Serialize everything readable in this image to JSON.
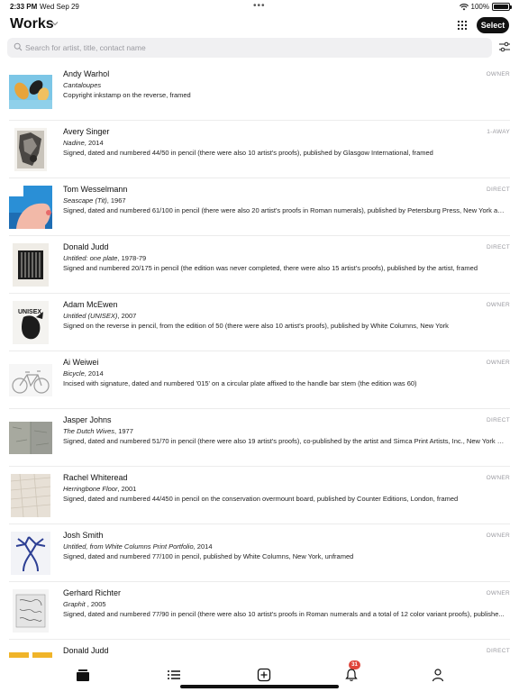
{
  "status": {
    "time": "2:33 PM",
    "date": "Wed Sep 29",
    "battery": "100%"
  },
  "header": {
    "title": "Works",
    "select_label": "Select"
  },
  "search": {
    "placeholder": "Search for artist, title, contact name"
  },
  "works": [
    {
      "artist": "Andy Warhol",
      "title": "Cantaloupes",
      "year": "",
      "description": "Copyright inkstamp on the reverse, framed",
      "relation": "OWNER"
    },
    {
      "artist": "Avery Singer",
      "title": "Nadine",
      "year": ", 2014",
      "description": "Signed, dated and numbered 44/50 in pencil (there were also 10 artist's proofs), published by Glasgow International, framed",
      "relation": "1-AWAY"
    },
    {
      "artist": "Tom Wesselmann",
      "title": "Seascape (Tit)",
      "year": ", 1967",
      "description": "Signed, dated and numbered 61/100 in pencil (there were also 20 artist's proofs in Roman numerals), published by Petersburg Press, New York and...",
      "relation": "DIRECT"
    },
    {
      "artist": "Donald Judd",
      "title": "Untitled: one plate",
      "year": ", 1978-79",
      "description": "Signed and numbered 20/175 in pencil (the edition was never completed, there were also 15 artist's proofs), published by the artist, framed",
      "relation": "DIRECT"
    },
    {
      "artist": "Adam McEwen",
      "title": "Untitled (UNISEX)",
      "year": ", 2007",
      "description": "Signed on the reverse in pencil, from the edition of 50 (there were also 10 artist's proofs), published by White Columns, New York",
      "relation": "OWNER"
    },
    {
      "artist": "Ai Weiwei",
      "title": "Bicycle",
      "year": ", 2014",
      "description": "Incised with signature, dated and numbered '015' on a circular plate affixed to the handle bar stem (the edition was 60)",
      "relation": "OWNER"
    },
    {
      "artist": "Jasper Johns",
      "title": "The Dutch Wives",
      "year": ", 1977",
      "description": "Signed, dated and numbered 51/70 in pencil (there were also 19 artist's proofs), co-published by the artist and Simca Print Artists, Inc., New York (...",
      "relation": "DIRECT"
    },
    {
      "artist": "Rachel Whiteread",
      "title": "Herringbone Floor",
      "year": ", 2001",
      "description": "Signed, dated and numbered 44/450 in pencil on the conservation overmount board, published by Counter Editions, London, framed",
      "relation": "OWNER"
    },
    {
      "artist": "Josh Smith",
      "title": "Untitled, from White Columns Print Portfolio",
      "year": ", 2014",
      "description": "Signed, dated and numbered 77/100 in pencil, published by White Columns, New York, unframed",
      "relation": "OWNER"
    },
    {
      "artist": "Gerhard Richter",
      "title": "Graphit",
      "year": " , 2005",
      "description": "Signed, dated and numbered 77/90 in pencil (there were also 10 artist's proofs in Roman numerals and a total of 12 color variant proofs), publishe...",
      "relation": "OWNER"
    },
    {
      "artist": "Donald Judd",
      "title": "",
      "year": "",
      "description": "",
      "relation": "DIRECT"
    }
  ],
  "thumb_text": {
    "unisex": "UNISEX"
  },
  "tabbar": {
    "notification_count": "31"
  },
  "icons": [
    "wifi-icon",
    "battery-icon",
    "chevron-down-icon",
    "grid-icon",
    "search-icon",
    "filter-icon",
    "works-tab-icon",
    "list-tab-icon",
    "add-tab-icon",
    "bell-tab-icon",
    "profile-tab-icon"
  ],
  "colors": {
    "accent": "#111111",
    "badge": "#e0453b"
  }
}
